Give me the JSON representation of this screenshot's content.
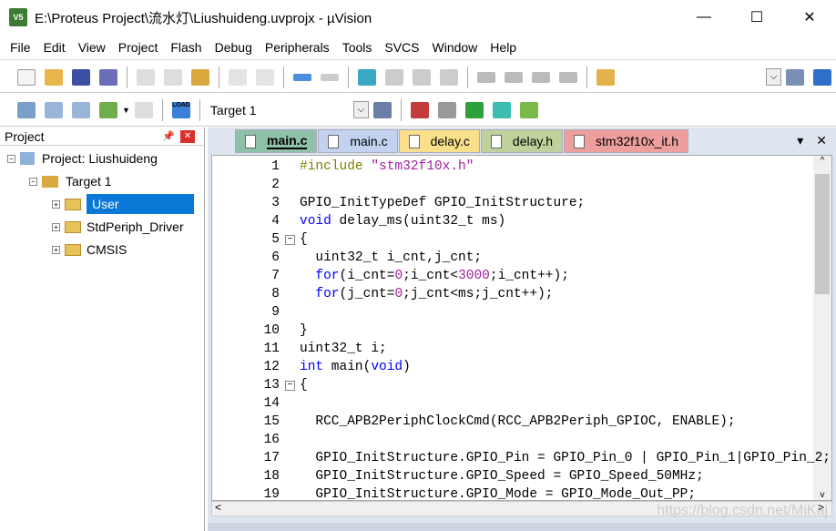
{
  "window": {
    "title": "E:\\Proteus Project\\流水灯\\Liushuideng.uvprojx - µVision",
    "app_icon": "uvision-icon",
    "controls": [
      "—",
      "☐",
      "✕"
    ]
  },
  "menu": [
    "File",
    "Edit",
    "View",
    "Project",
    "Flash",
    "Debug",
    "Peripherals",
    "Tools",
    "SVCS",
    "Window",
    "Help"
  ],
  "toolbar2": {
    "target": "Target 1",
    "load_label": "LOAD"
  },
  "project": {
    "header": "Project",
    "root": "Project: Liushuideng",
    "target": "Target 1",
    "groups": [
      "User",
      "StdPeriph_Driver",
      "CMSIS"
    ],
    "selected": "User"
  },
  "tabs": [
    {
      "label": "main.c",
      "color": "#8fc1a9",
      "active": true
    },
    {
      "label": "main.c",
      "color": "#c3d3ef",
      "active": false
    },
    {
      "label": "delay.c",
      "color": "#fbe08c",
      "active": false
    },
    {
      "label": "delay.h",
      "color": "#bfd29c",
      "active": false
    },
    {
      "label": "stm32f10x_it.h",
      "color": "#ef9e9e",
      "active": false
    }
  ],
  "code": [
    {
      "n": "1",
      "html": "<span class='pp'>#include</span> <span class='str'>\"stm32f10x.h\"</span>"
    },
    {
      "n": "2",
      "html": ""
    },
    {
      "n": "3",
      "html": "GPIO_InitTypeDef GPIO_InitStructure;"
    },
    {
      "n": "4",
      "html": "<span class='kw'>void</span> delay_ms(uint32_t ms)"
    },
    {
      "n": "5",
      "html": "{",
      "fold": "−"
    },
    {
      "n": "6",
      "html": "  uint32_t i_cnt,j_cnt;"
    },
    {
      "n": "7",
      "html": "  <span class='kw'>for</span>(i_cnt=<span class='num'>0</span>;i_cnt&lt;<span class='num'>3000</span>;i_cnt++);"
    },
    {
      "n": "8",
      "html": "  <span class='kw'>for</span>(j_cnt=<span class='num'>0</span>;j_cnt&lt;ms;j_cnt++);"
    },
    {
      "n": "9",
      "html": ""
    },
    {
      "n": "10",
      "html": "}"
    },
    {
      "n": "11",
      "html": "uint32_t i;"
    },
    {
      "n": "12",
      "html": "<span class='kw'>int</span> main(<span class='kw'>void</span>)"
    },
    {
      "n": "13",
      "html": "{",
      "fold": "−"
    },
    {
      "n": "14",
      "html": ""
    },
    {
      "n": "15",
      "html": "  RCC_APB2PeriphClockCmd(RCC_APB2Periph_GPIOC, ENABLE);"
    },
    {
      "n": "16",
      "html": ""
    },
    {
      "n": "17",
      "html": "  GPIO_InitStructure.GPIO_Pin = GPIO_Pin_0 | GPIO_Pin_1|GPIO_Pin_2;"
    },
    {
      "n": "18",
      "html": "  GPIO_InitStructure.GPIO_Speed = GPIO_Speed_50MHz;"
    },
    {
      "n": "19",
      "html": "  GPIO_InitStructure.GPIO_Mode = GPIO_Mode_Out_PP;"
    }
  ],
  "watermark": "https://blog.csdn.net/MiKaj"
}
